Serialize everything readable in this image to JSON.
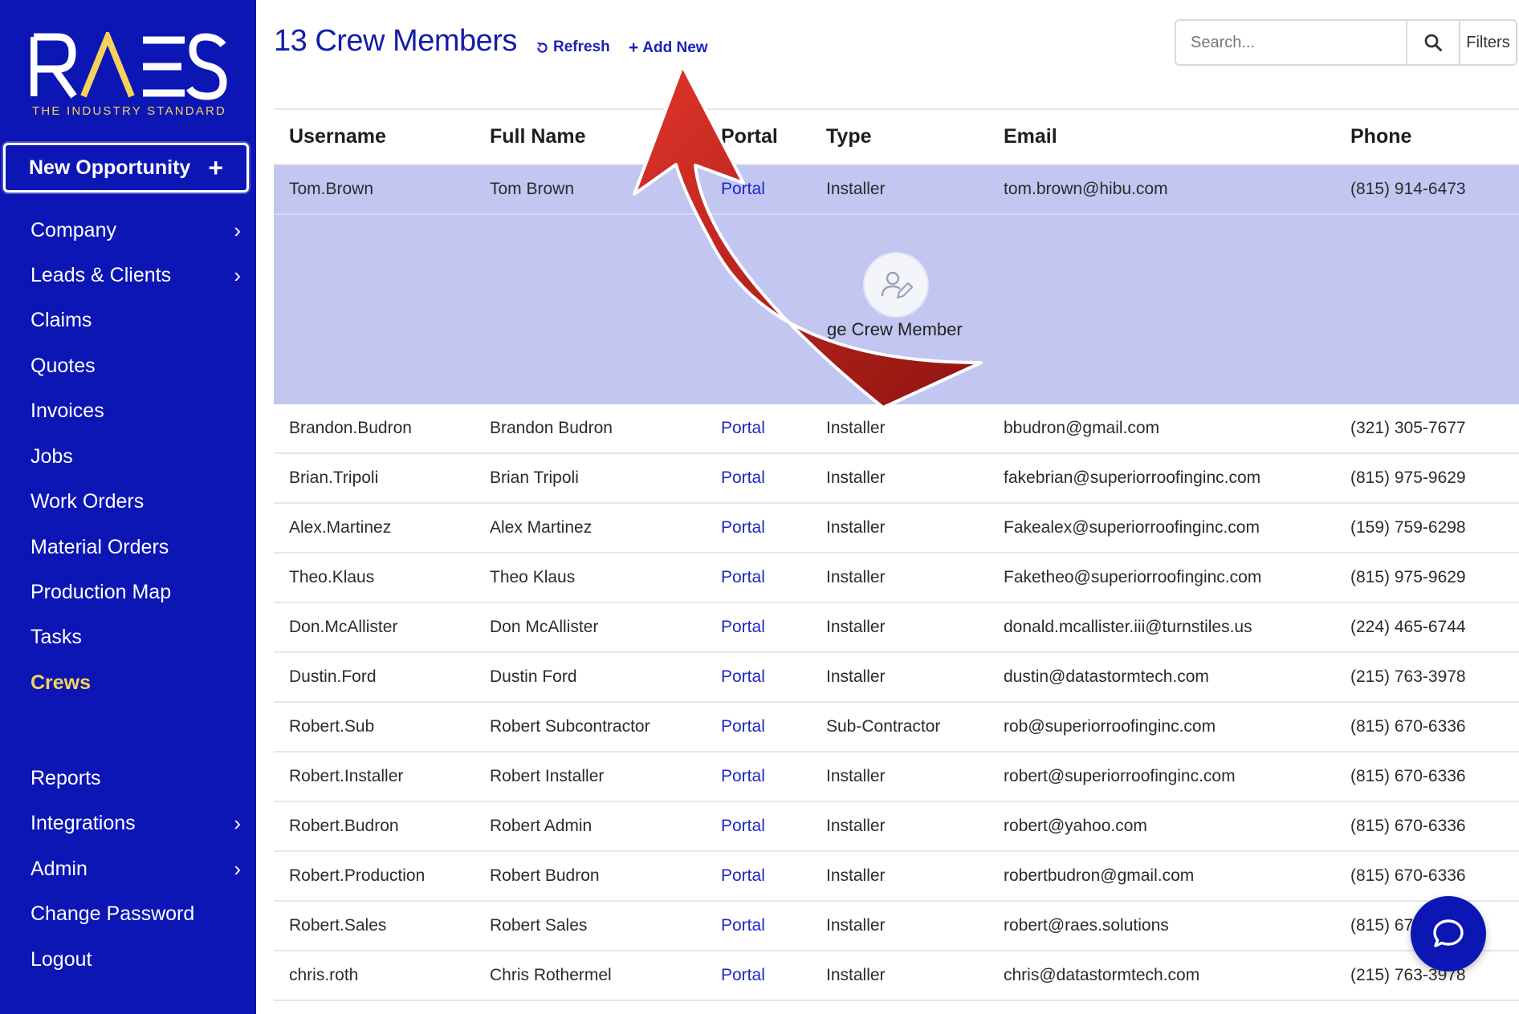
{
  "brand": {
    "logo_text": "RAES",
    "tagline": "THE INDUSTRY STANDARD",
    "primary_color": "#0c16b4",
    "accent_color": "#f5d35a"
  },
  "sidebar": {
    "new_opportunity_label": "New Opportunity",
    "items": [
      {
        "label": "Company",
        "has_submenu": true
      },
      {
        "label": "Leads & Clients",
        "has_submenu": true
      },
      {
        "label": "Claims",
        "has_submenu": false
      },
      {
        "label": "Quotes",
        "has_submenu": false
      },
      {
        "label": "Invoices",
        "has_submenu": false
      },
      {
        "label": "Jobs",
        "has_submenu": false
      },
      {
        "label": "Work Orders",
        "has_submenu": false
      },
      {
        "label": "Material Orders",
        "has_submenu": false
      },
      {
        "label": "Production Map",
        "has_submenu": false
      },
      {
        "label": "Tasks",
        "has_submenu": false
      },
      {
        "label": "Crews",
        "has_submenu": false,
        "active": true
      },
      {
        "label": "Reports",
        "has_submenu": false
      },
      {
        "label": "Integrations",
        "has_submenu": true
      },
      {
        "label": "Admin",
        "has_submenu": true
      },
      {
        "label": "Change Password",
        "has_submenu": false
      },
      {
        "label": "Logout",
        "has_submenu": false
      }
    ]
  },
  "header": {
    "title": "13 Crew Members",
    "refresh_label": "Refresh",
    "add_new_label": "Add New",
    "search_placeholder": "Search...",
    "filters_label": "Filters"
  },
  "table": {
    "columns": [
      "Username",
      "Full Name",
      "Portal",
      "Type",
      "Email",
      "Phone"
    ],
    "rows": [
      {
        "username": "Tom.Brown",
        "full_name": "Tom Brown",
        "portal": "Portal",
        "type": "Installer",
        "email": "tom.brown@hibu.com",
        "phone": "(815) 914-6473"
      },
      {
        "username": "Brandon.Budron",
        "full_name": "Brandon Budron",
        "portal": "Portal",
        "type": "Installer",
        "email": "bbudron@gmail.com",
        "phone": "(321) 305-7677"
      },
      {
        "username": "Brian.Tripoli",
        "full_name": "Brian Tripoli",
        "portal": "Portal",
        "type": "Installer",
        "email": "fakebrian@superiorroofinginc.com",
        "phone": "(815) 975-9629"
      },
      {
        "username": "Alex.Martinez",
        "full_name": "Alex Martinez",
        "portal": "Portal",
        "type": "Installer",
        "email": "Fakealex@superiorroofinginc.com",
        "phone": "(159) 759-6298"
      },
      {
        "username": "Theo.Klaus",
        "full_name": "Theo Klaus",
        "portal": "Portal",
        "type": "Installer",
        "email": "Faketheo@superiorroofinginc.com",
        "phone": "(815) 975-9629"
      },
      {
        "username": "Don.McAllister",
        "full_name": "Don McAllister",
        "portal": "Portal",
        "type": "Installer",
        "email": "donald.mcallister.iii@turnstiles.us",
        "phone": "(224) 465-6744"
      },
      {
        "username": "Dustin.Ford",
        "full_name": "Dustin Ford",
        "portal": "Portal",
        "type": "Installer",
        "email": "dustin@datastormtech.com",
        "phone": "(215) 763-3978"
      },
      {
        "username": "Robert.Sub",
        "full_name": "Robert Subcontractor",
        "portal": "Portal",
        "type": "Sub-Contractor",
        "email": "rob@superiorroofinginc.com",
        "phone": "(815) 670-6336"
      },
      {
        "username": "Robert.Installer",
        "full_name": "Robert Installer",
        "portal": "Portal",
        "type": "Installer",
        "email": "robert@superiorroofinginc.com",
        "phone": "(815) 670-6336"
      },
      {
        "username": "Robert.Budron",
        "full_name": "Robert Admin",
        "portal": "Portal",
        "type": "Installer",
        "email": "robert@yahoo.com",
        "phone": "(815) 670-6336"
      },
      {
        "username": "Robert.Production",
        "full_name": "Robert Budron",
        "portal": "Portal",
        "type": "Installer",
        "email": "robertbudron@gmail.com",
        "phone": "(815) 670-6336"
      },
      {
        "username": "Robert.Sales",
        "full_name": "Robert Sales",
        "portal": "Portal",
        "type": "Installer",
        "email": "robert@raes.solutions",
        "phone": "(815) 67"
      },
      {
        "username": "chris.roth",
        "full_name": "Chris Rothermel",
        "portal": "Portal",
        "type": "Installer",
        "email": "chris@datastormtech.com",
        "phone": "(215) 763-3978"
      }
    ],
    "expanded_action_label": "ge Crew Member",
    "selected_row_color": "#c2c6f0"
  },
  "annotation": {
    "arrow_color": "#c4231d"
  }
}
